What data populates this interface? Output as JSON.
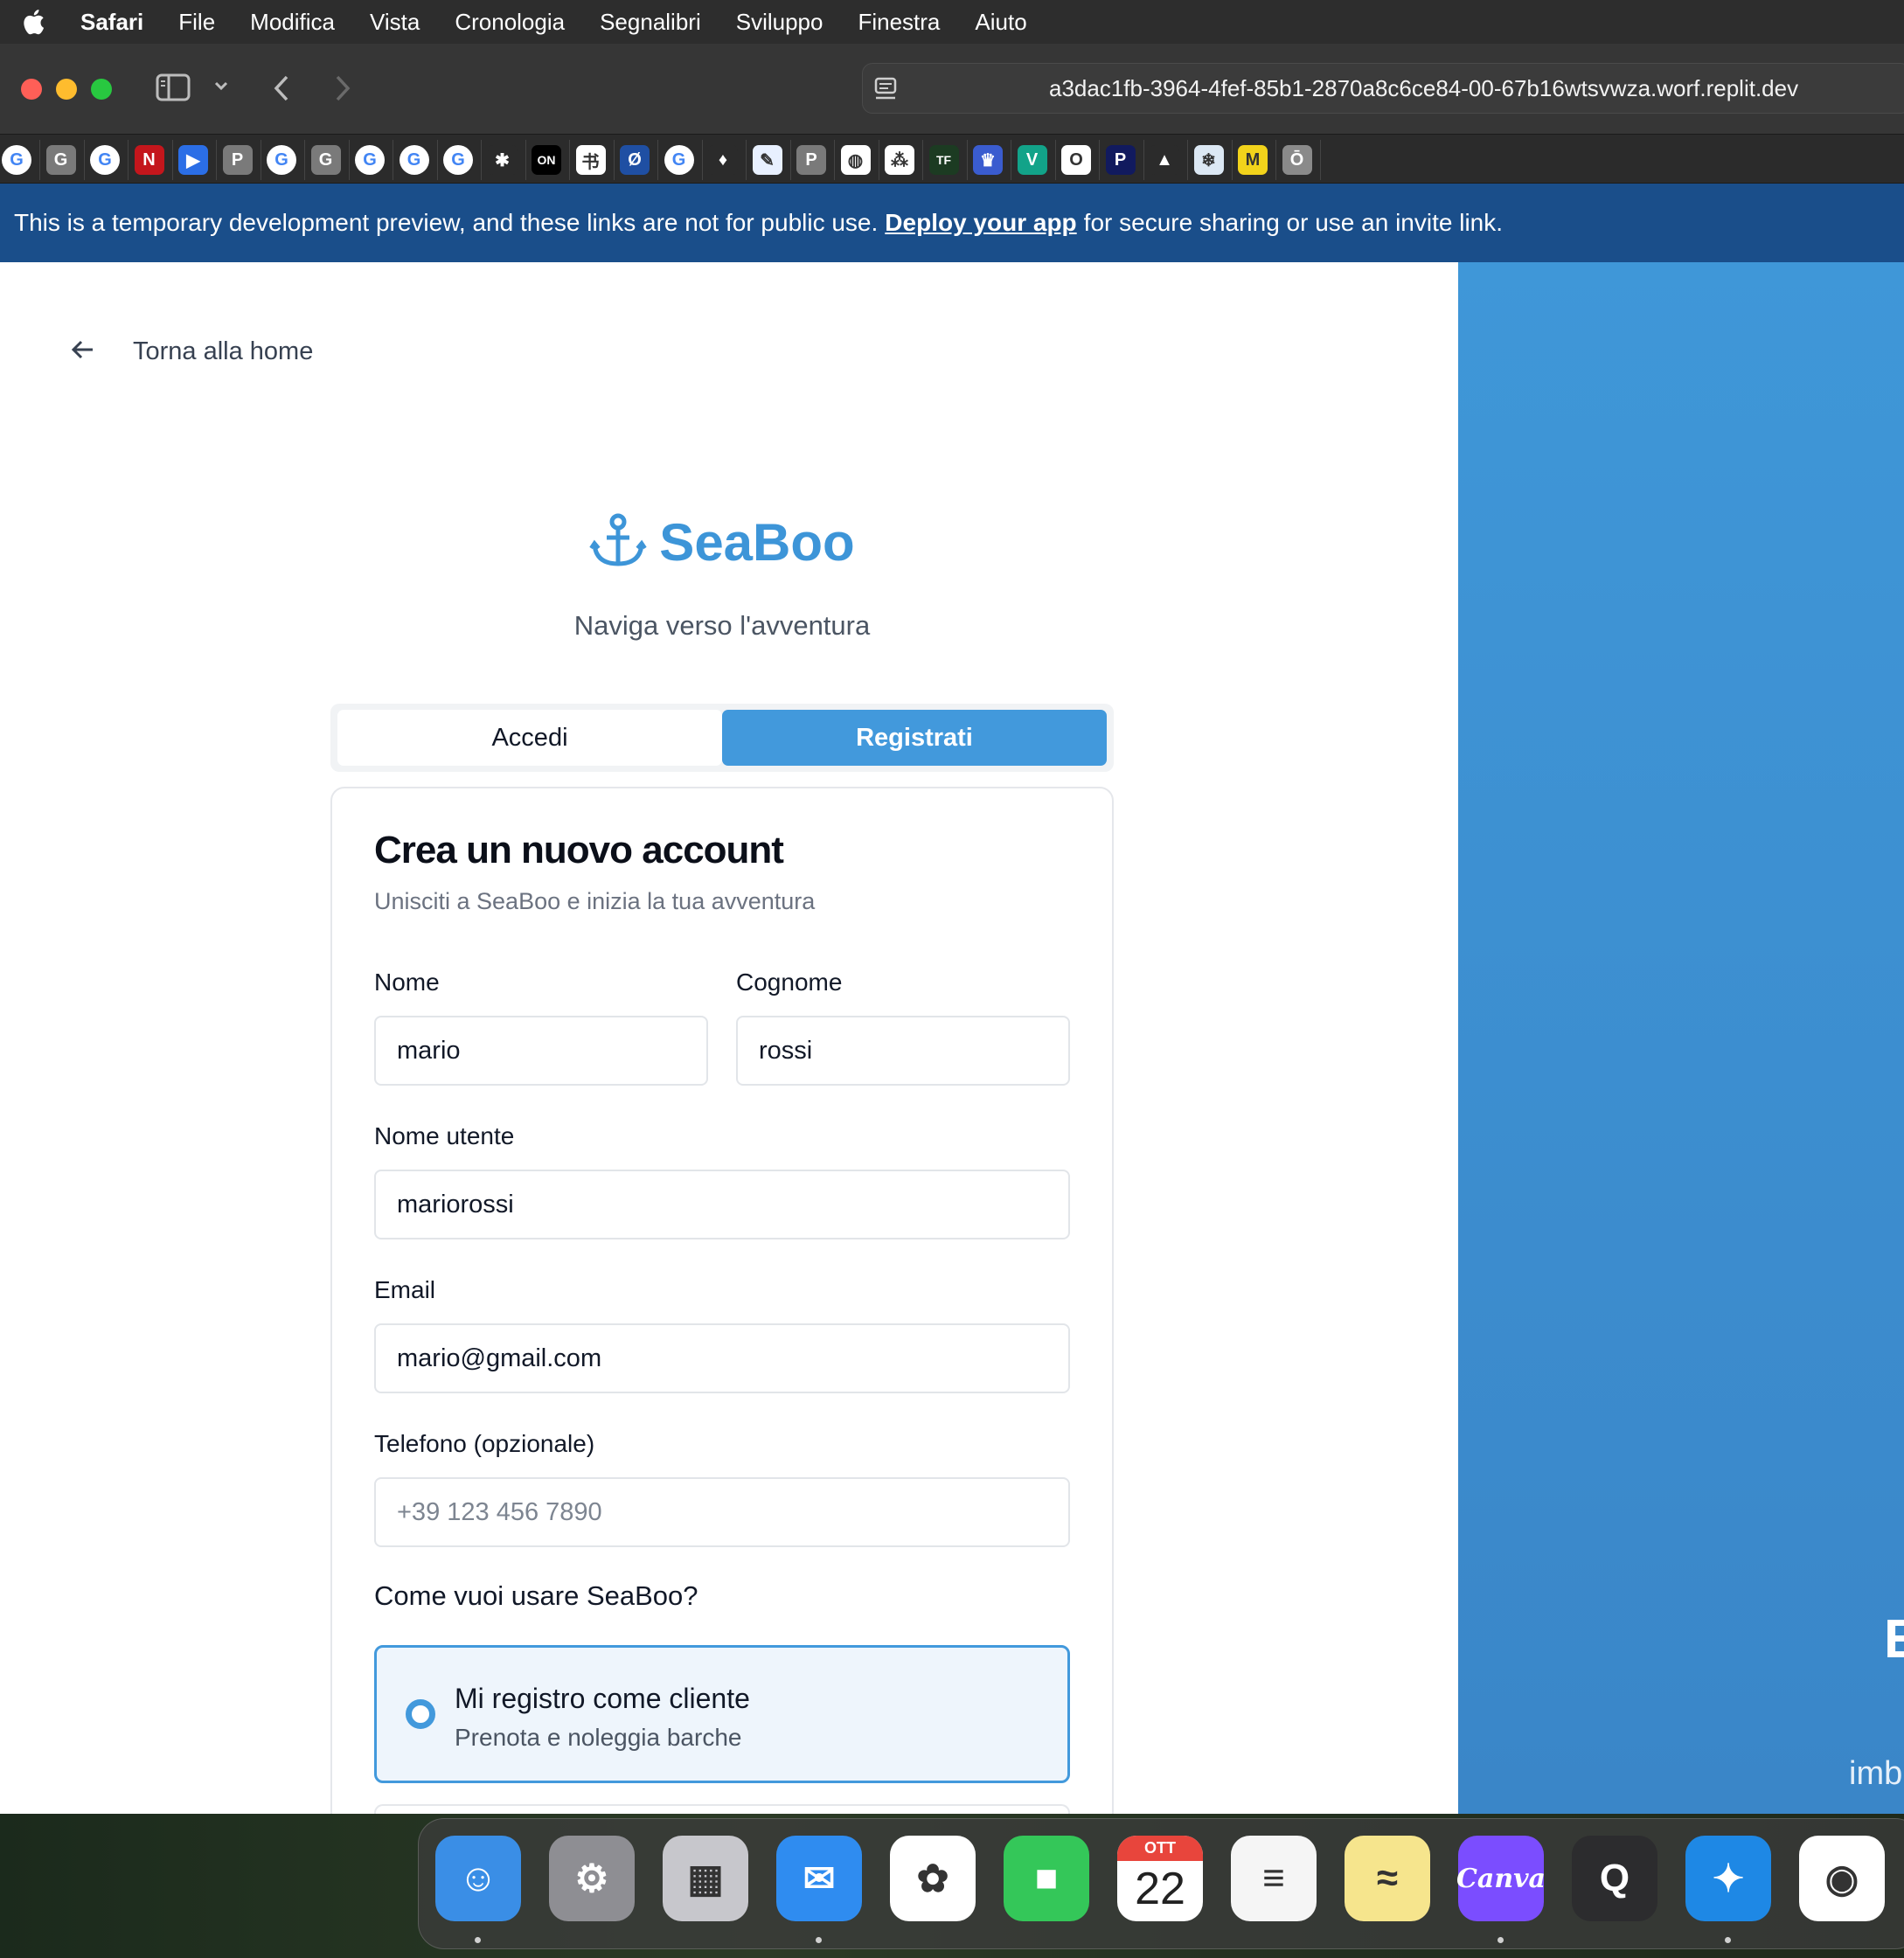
{
  "menubar": {
    "app": "Safari",
    "items": [
      "File",
      "Modifica",
      "Vista",
      "Cronologia",
      "Segnalibri",
      "Sviluppo",
      "Finestra",
      "Aiuto"
    ]
  },
  "browser": {
    "url": "a3dac1fb-3964-4fef-85b1-2870a8c6ce84-00-67b16wtsvwza.worf.replit.dev"
  },
  "favorites": [
    {
      "icon": "google-icon",
      "glyph": "G",
      "color": "#ffffff"
    },
    {
      "icon": "g-gray-icon",
      "glyph": "G",
      "color": "#7a7a7a"
    },
    {
      "icon": "google-icon",
      "glyph": "G",
      "color": "#ffffff"
    },
    {
      "icon": "netflix-icon",
      "glyph": "N",
      "color": "#c4161c"
    },
    {
      "icon": "play-icon",
      "glyph": "▶",
      "color": "#2b6ee6"
    },
    {
      "icon": "p-gray-icon",
      "glyph": "P",
      "color": "#7a7a7a"
    },
    {
      "icon": "google-icon",
      "glyph": "G",
      "color": "#ffffff"
    },
    {
      "icon": "g-gray-icon",
      "glyph": "G",
      "color": "#7a7a7a"
    },
    {
      "icon": "google-icon",
      "glyph": "G",
      "color": "#ffffff"
    },
    {
      "icon": "google-icon",
      "glyph": "G",
      "color": "#ffffff"
    },
    {
      "icon": "google-icon",
      "glyph": "G",
      "color": "#ffffff"
    },
    {
      "icon": "colorful-icon",
      "glyph": "✱",
      "color": "#2b2b2b"
    },
    {
      "icon": "on-icon",
      "glyph": "ON",
      "color": "#000000"
    },
    {
      "icon": "chinese-icon",
      "glyph": "书",
      "color": "#ffffff"
    },
    {
      "icon": "circle-blue-icon",
      "glyph": "Ø",
      "color": "#1f4fa3"
    },
    {
      "icon": "google-icon",
      "glyph": "G",
      "color": "#ffffff"
    },
    {
      "icon": "lamp-icon",
      "glyph": "♦",
      "color": "#2b2b2b"
    },
    {
      "icon": "image-icon",
      "glyph": "✎",
      "color": "#e8f0ff"
    },
    {
      "icon": "p-gray-icon",
      "glyph": "P",
      "color": "#7a7a7a"
    },
    {
      "icon": "globe-icon",
      "glyph": "◍",
      "color": "#ffffff"
    },
    {
      "icon": "dots-icon",
      "glyph": "⁂",
      "color": "#ffffff"
    },
    {
      "icon": "tf-icon",
      "glyph": "TF",
      "color": "#1c3b22"
    },
    {
      "icon": "badge-icon",
      "glyph": "♛",
      "color": "#3a5ccf"
    },
    {
      "icon": "v-icon",
      "glyph": "V",
      "color": "#12a389"
    },
    {
      "icon": "o-icon",
      "glyph": "O",
      "color": "#ffffff"
    },
    {
      "icon": "p-dark-icon",
      "glyph": "P",
      "color": "#111a5e"
    },
    {
      "icon": "ads-icon",
      "glyph": "▲",
      "color": "#2b2b2b"
    },
    {
      "icon": "snow-icon",
      "glyph": "❄",
      "color": "#dce8f4"
    },
    {
      "icon": "miro-icon",
      "glyph": "M",
      "color": "#f2d31b"
    },
    {
      "icon": "o-bar-icon",
      "glyph": "Ō",
      "color": "#8a8a8a"
    }
  ],
  "banner": {
    "text_before": "This is a temporary development preview, and these links are not for public use.",
    "link": "Deploy your app",
    "text_after": "for secure sharing or use an invite link."
  },
  "page": {
    "back_label": "Torna alla home",
    "brand": "SeaBoo",
    "tagline": "Naviga verso l'avventura",
    "tabs": {
      "login": "Accedi",
      "register": "Registrati"
    },
    "card_title": "Crea un nuovo account",
    "card_subtitle": "Unisciti a SeaBoo e inizia la tua avventura",
    "fields": {
      "first_name_label": "Nome",
      "first_name_value": "mario",
      "last_name_label": "Cognome",
      "last_name_value": "rossi",
      "username_label": "Nome utente",
      "username_value": "mariorossi",
      "email_label": "Email",
      "email_value": "mario@gmail.com",
      "phone_label": "Telefono (opzionale)",
      "phone_placeholder": "+39 123 456 7890"
    },
    "role_question": "Come vuoi usare SeaBoo?",
    "role_option": {
      "title": "Mi registro come cliente",
      "desc": "Prenota e noleggia barche"
    },
    "hero_letter": "E",
    "hero_text": "imb"
  },
  "dock": [
    {
      "icon": "finder-icon",
      "glyph": "☺",
      "color": "#3a8ee6"
    },
    {
      "icon": "system-settings-icon",
      "glyph": "⚙",
      "color": "#8e8e93"
    },
    {
      "icon": "launchpad-icon",
      "glyph": "▦",
      "color": "#c7c7cc"
    },
    {
      "icon": "mail-icon",
      "glyph": "✉",
      "color": "#2f8cf0"
    },
    {
      "icon": "photos-icon",
      "glyph": "✿",
      "color": "#ffffff"
    },
    {
      "icon": "facetime-icon",
      "glyph": "■",
      "color": "#34c759"
    },
    {
      "icon": "calendar-icon",
      "glyph": "22",
      "color": "#ffffff",
      "month": "OTT"
    },
    {
      "icon": "notes-icon",
      "glyph": "≡",
      "color": "#f5f5f5"
    },
    {
      "icon": "stickies-icon",
      "glyph": "≈",
      "color": "#f6e58d"
    },
    {
      "icon": "canva-icon",
      "glyph": "Canva",
      "color": "#7b4dff"
    },
    {
      "icon": "quicktime-icon",
      "glyph": "Q",
      "color": "#2c2c2e"
    },
    {
      "icon": "safari-icon",
      "glyph": "✦",
      "color": "#1e88e5"
    },
    {
      "icon": "chrome-icon",
      "glyph": "◉",
      "color": "#ffffff"
    }
  ]
}
